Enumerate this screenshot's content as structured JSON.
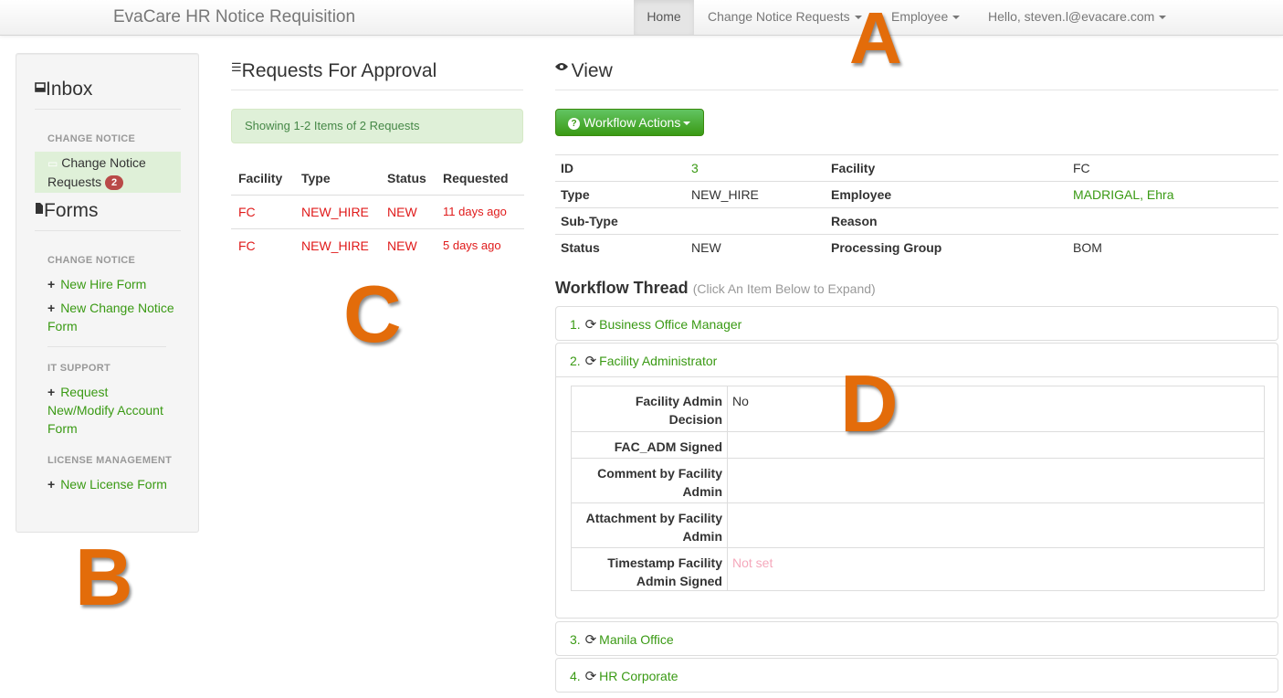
{
  "navbar": {
    "brand": "EvaCare HR Notice Requisition",
    "home": "Home",
    "change_notice_requests": "Change Notice Requests",
    "employee": "Employee",
    "user": "Hello, steven.l@evacare.com"
  },
  "annotations": {
    "a": "A",
    "b": "B",
    "c": "C",
    "d": "D",
    "color": "#e36c0a"
  },
  "sidebar": {
    "inbox_title": "Inbox",
    "inbox_section": "CHANGE NOTICE",
    "inbox_item_label": "Change Notice Requests",
    "inbox_item_count": "2",
    "forms_title": "Forms",
    "sections": [
      {
        "title": "CHANGE NOTICE",
        "links": [
          "New Hire Form",
          "New Change Notice Form"
        ]
      },
      {
        "title": "IT SUPPORT",
        "links": [
          "Request New/Modify Account Form"
        ]
      },
      {
        "title": "LICENSE MANAGEMENT",
        "links": [
          "New License Form"
        ]
      }
    ]
  },
  "requests": {
    "title": "Requests For Approval",
    "alert": "Showing 1-2 Items of 2 Requests",
    "columns": [
      "Facility",
      "Type",
      "Status",
      "Requested"
    ],
    "rows": [
      {
        "facility": "FC",
        "type": "NEW_HIRE",
        "status": "NEW",
        "requested": "11 days ago"
      },
      {
        "facility": "FC",
        "type": "NEW_HIRE",
        "status": "NEW",
        "requested": "5 days ago"
      }
    ]
  },
  "view": {
    "title": "View",
    "workflow_button": "Workflow Actions",
    "details": [
      {
        "k1": "ID",
        "v1": "3",
        "k2": "Facility",
        "v2": "FC"
      },
      {
        "k1": "Type",
        "v1": "NEW_HIRE",
        "k2": "Employee",
        "v2": "MADRIGAL, Ehra"
      },
      {
        "k1": "Sub-Type",
        "v1": "",
        "k2": "Reason",
        "v2": ""
      },
      {
        "k1": "Status",
        "v1": "NEW",
        "k2": "Processing Group",
        "v2": "BOM"
      }
    ],
    "thread_title": "Workflow Thread",
    "thread_hint": "(Click An Item Below to Expand)",
    "steps": [
      {
        "num": "1.",
        "label": "Business Office Manager"
      },
      {
        "num": "2.",
        "label": "Facility Administrator"
      },
      {
        "num": "3.",
        "label": "Manila Office"
      },
      {
        "num": "4.",
        "label": "HR Corporate"
      }
    ],
    "expanded_fields": [
      {
        "label_lines": [
          "Facility Admin",
          "Decision"
        ],
        "value": "No"
      },
      {
        "label_lines": [
          "FAC_ADM Signed"
        ],
        "value": ""
      },
      {
        "label_lines": [
          "Comment by Facility",
          "Admin"
        ],
        "value": ""
      },
      {
        "label_lines": [
          "Attachment by Facility",
          "Admin"
        ],
        "value": ""
      },
      {
        "label_lines": [
          "Timestamp Facility",
          "Admin Signed"
        ],
        "value": "Not set"
      }
    ]
  },
  "colors": {
    "green": "#3a9a14",
    "red": "#e01b1b",
    "badge": "#b94a48",
    "alert_bg": "#dff0d8",
    "placeholder_pink": "#f5a9bc"
  }
}
